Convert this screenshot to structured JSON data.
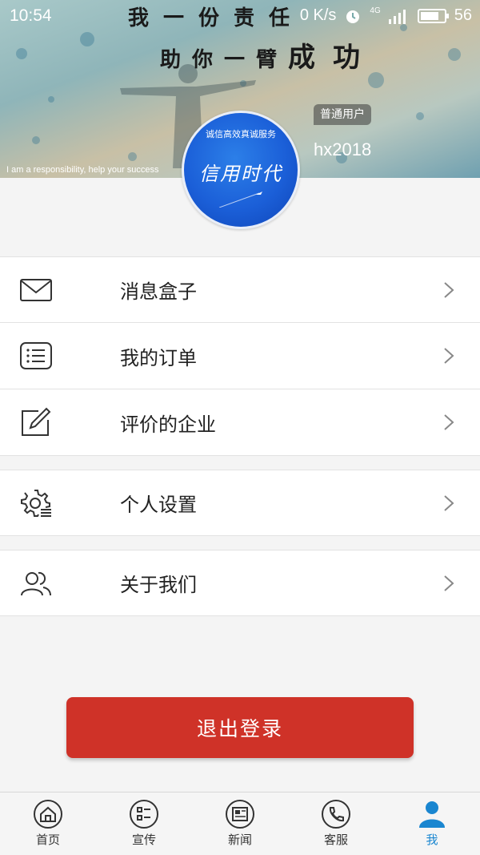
{
  "status_bar": {
    "time": "10:54",
    "network_speed": "0 K/s",
    "signal": "4G",
    "battery": "56"
  },
  "header": {
    "slogan_line1": "我一份责任",
    "slogan_line2_a": "助你一臂",
    "slogan_line2_b": "成功",
    "slogan_english": "I am a responsibility, help your success",
    "user_type": "普通用户",
    "username": "hx2018",
    "avatar_tagline": "诚信高效真诚服务",
    "avatar_brand": "信用时代"
  },
  "menu": {
    "group1": [
      {
        "label": "消息盒子",
        "icon": "envelope-icon"
      },
      {
        "label": "我的订单",
        "icon": "order-list-icon"
      },
      {
        "label": "评价的企业",
        "icon": "edit-icon"
      }
    ],
    "group2": [
      {
        "label": "个人设置",
        "icon": "settings-gear-icon"
      }
    ],
    "group3": [
      {
        "label": "关于我们",
        "icon": "users-icon"
      }
    ]
  },
  "logout_label": "退出登录",
  "tabs": [
    {
      "label": "首页",
      "icon": "home-icon"
    },
    {
      "label": "宣传",
      "icon": "promo-icon"
    },
    {
      "label": "新闻",
      "icon": "news-icon"
    },
    {
      "label": "客服",
      "icon": "phone-icon"
    },
    {
      "label": "我",
      "icon": "person-icon",
      "active": true
    }
  ],
  "colors": {
    "accent": "#1a86d0",
    "logout": "#cf3228",
    "avatar": "#1b5fd8"
  }
}
